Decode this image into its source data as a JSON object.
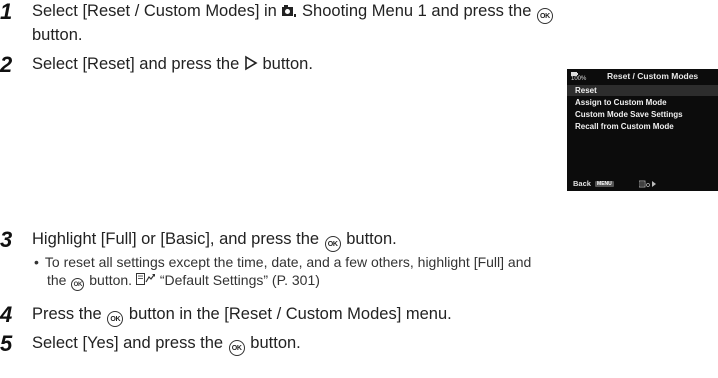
{
  "steps": [
    {
      "num": "1",
      "text_a": "Select [Reset / Custom Modes] in",
      "icon": "shooting-menu-icon",
      "text_b": "Shooting Menu 1 and press the",
      "ok": "OK",
      "text_c": "button."
    },
    {
      "num": "2",
      "text_a": "Select [Reset] and press the",
      "text_b": "button."
    },
    {
      "num": "3",
      "text_a": "Highlight [Full] or [Basic], and press the",
      "ok": "OK",
      "text_b": "button."
    },
    {
      "num": "4",
      "text_a": "Press the",
      "ok": "OK",
      "text_b": "button in the [Reset / Custom Modes] menu."
    },
    {
      "num": "5",
      "text_a": "Select [Yes] and press the",
      "ok": "OK",
      "text_b": "button."
    }
  ],
  "bullet": {
    "mark": "•",
    "line1": "To reset all settings except the time, date, and a few others, highlight [Full] and",
    "line2_a": "the",
    "ok": "OK",
    "line2_b": "button.",
    "ref_text": "“Default Settings” (P. 301)"
  },
  "screen": {
    "battery_label": "100%",
    "title": "Reset / Custom Modes",
    "items": [
      "Reset",
      "Assign to Custom Mode",
      "Custom Mode Save Settings",
      "Recall from Custom Mode"
    ],
    "back_label": "Back",
    "menu_badge": "MENU"
  }
}
